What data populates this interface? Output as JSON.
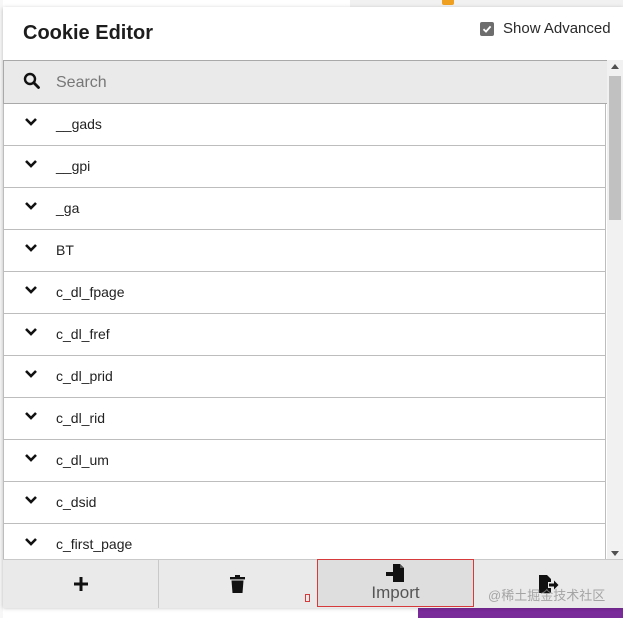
{
  "header": {
    "title": "Cookie Editor",
    "show_advanced_label": "Show Advanced",
    "show_advanced_checked": true
  },
  "search": {
    "placeholder": "Search",
    "value": ""
  },
  "cookies": [
    {
      "name": "__gads"
    },
    {
      "name": "__gpi"
    },
    {
      "name": "_ga"
    },
    {
      "name": "BT"
    },
    {
      "name": "c_dl_fpage"
    },
    {
      "name": "c_dl_fref"
    },
    {
      "name": "c_dl_prid"
    },
    {
      "name": "c_dl_rid"
    },
    {
      "name": "c_dl_um"
    },
    {
      "name": "c_dsid"
    },
    {
      "name": "c_first_page"
    }
  ],
  "toolbar": {
    "add_icon": "plus-icon",
    "delete_icon": "trash-icon",
    "import_icon": "file-import-icon",
    "import_label": "Import",
    "export_icon": "file-export-icon"
  },
  "watermark": "@稀土掘金技术社区",
  "colors": {
    "toolbar_bg": "#eaeaea",
    "search_bg": "#eaeaea",
    "import_border": "#d63a3a",
    "checkbox": "#6d6d6d"
  }
}
